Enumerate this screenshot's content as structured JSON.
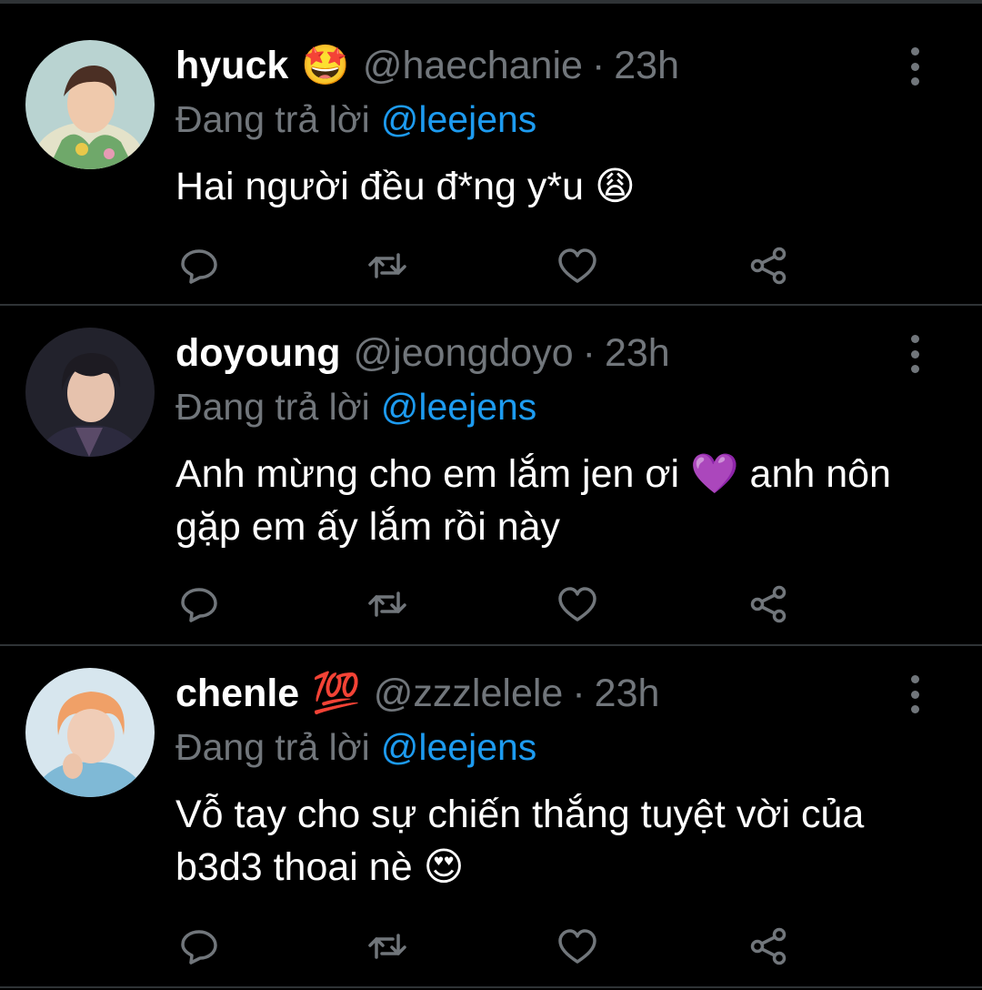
{
  "reply_prefix": "Đang trả lời",
  "colors": {
    "background": "#000000",
    "divider": "#2f3336",
    "secondary_text": "#71767b",
    "mention": "#1d9bf0",
    "primary_text": "#ffffff"
  },
  "tweets": [
    {
      "name": "hyuck",
      "badge_emoji": "🤩",
      "handle": "@haechanie",
      "separator": "·",
      "time": "23h",
      "reply_to": "@leejens",
      "text": "Hai người đều đ*ng y*u 😩",
      "avatar_icon": "avatar-photo",
      "actions": [
        "reply-icon",
        "retweet-icon",
        "like-icon",
        "share-icon"
      ]
    },
    {
      "name": "doyoung",
      "badge_emoji": "",
      "handle": "@jeongdoyo",
      "separator": "·",
      "time": "23h",
      "reply_to": "@leejens",
      "text": "Anh mừng cho em lắm jen ơi 💜 anh nôn gặp em ấy lắm rồi này",
      "avatar_icon": "avatar-photo",
      "actions": [
        "reply-icon",
        "retweet-icon",
        "like-icon",
        "share-icon"
      ]
    },
    {
      "name": "chenle",
      "badge_emoji": "💯",
      "handle": "@zzzlelele",
      "separator": "·",
      "time": "23h",
      "reply_to": "@leejens",
      "text": "Vỗ tay cho sự chiến thắng tuyệt vời của b3d3 thoai nè 😍",
      "avatar_icon": "avatar-photo",
      "actions": [
        "reply-icon",
        "retweet-icon",
        "like-icon",
        "share-icon"
      ]
    }
  ]
}
